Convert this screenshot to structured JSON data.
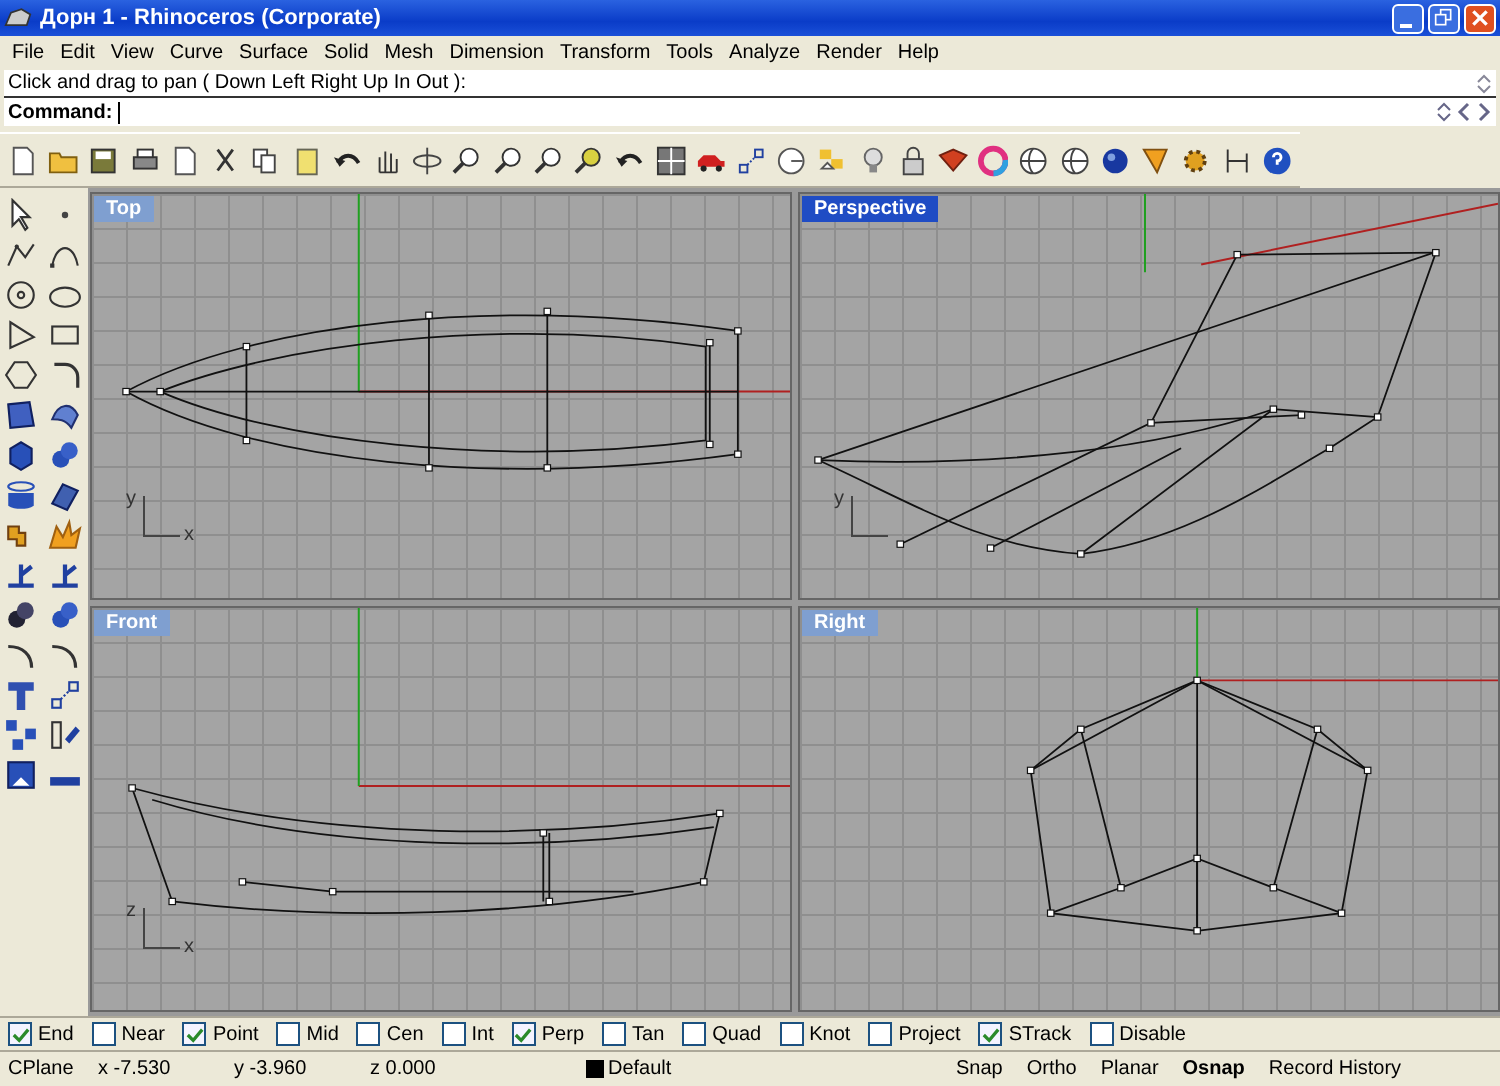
{
  "window": {
    "title": "Дорн 1 - Rhinoceros (Corporate)"
  },
  "menu": [
    "File",
    "Edit",
    "View",
    "Curve",
    "Surface",
    "Solid",
    "Mesh",
    "Dimension",
    "Transform",
    "Tools",
    "Analyze",
    "Render",
    "Help"
  ],
  "command": {
    "history": "Click and drag to pan ( Down  Left  Right  Up  In  Out ):",
    "prompt": "Command:"
  },
  "viewports": [
    {
      "title": "Top",
      "selected": false,
      "kind": "top",
      "axis_labels": [
        "y",
        "x"
      ]
    },
    {
      "title": "Perspective",
      "selected": true,
      "kind": "perspective",
      "axis_labels": [
        "y"
      ]
    },
    {
      "title": "Front",
      "selected": false,
      "kind": "front",
      "axis_labels": [
        "z",
        "x"
      ]
    },
    {
      "title": "Right",
      "selected": false,
      "kind": "right"
    }
  ],
  "osnap": [
    {
      "label": "End",
      "checked": true
    },
    {
      "label": "Near",
      "checked": false
    },
    {
      "label": "Point",
      "checked": true
    },
    {
      "label": "Mid",
      "checked": false
    },
    {
      "label": "Cen",
      "checked": false
    },
    {
      "label": "Int",
      "checked": false
    },
    {
      "label": "Perp",
      "checked": true
    },
    {
      "label": "Tan",
      "checked": false
    },
    {
      "label": "Quad",
      "checked": false
    },
    {
      "label": "Knot",
      "checked": false
    },
    {
      "label": "Project",
      "checked": false
    },
    {
      "label": "STrack",
      "checked": true
    },
    {
      "label": "Disable",
      "checked": false
    }
  ],
  "status_bar": {
    "cplane": "CPlane",
    "x": "x -7.530",
    "y": "y -3.960",
    "z": "z 0.000",
    "layer": "Default",
    "toggles": [
      {
        "label": "Snap",
        "on": false
      },
      {
        "label": "Ortho",
        "on": false
      },
      {
        "label": "Planar",
        "on": false
      },
      {
        "label": "Osnap",
        "on": true
      },
      {
        "label": "Record History",
        "on": false
      }
    ]
  }
}
